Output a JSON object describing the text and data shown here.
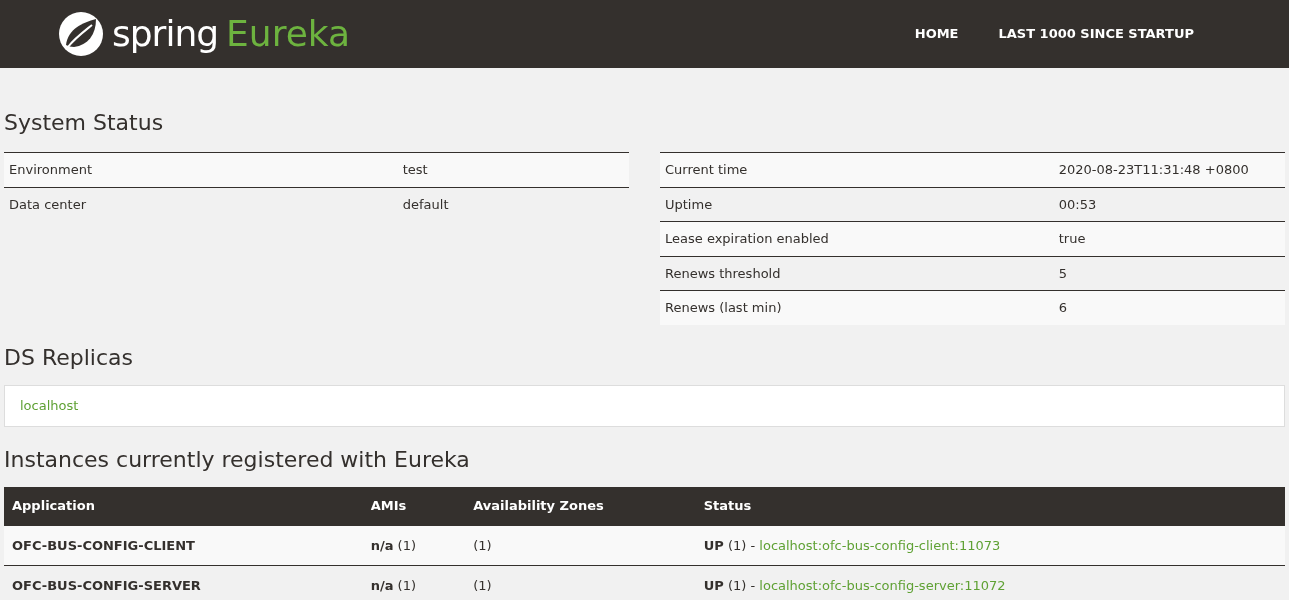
{
  "header": {
    "logo_word": "spring",
    "logo_product": "Eureka",
    "nav": [
      {
        "label": "HOME"
      },
      {
        "label": "LAST 1000 SINCE STARTUP"
      }
    ]
  },
  "system_status": {
    "title": "System Status",
    "left": [
      {
        "label": "Environment",
        "value": "test"
      },
      {
        "label": "Data center",
        "value": "default"
      }
    ],
    "right": [
      {
        "label": "Current time",
        "value": "2020-08-23T11:31:48 +0800"
      },
      {
        "label": "Uptime",
        "value": "00:53"
      },
      {
        "label": "Lease expiration enabled",
        "value": "true"
      },
      {
        "label": "Renews threshold",
        "value": "5"
      },
      {
        "label": "Renews (last min)",
        "value": "6"
      }
    ]
  },
  "ds_replicas": {
    "title": "DS Replicas",
    "items": [
      "localhost"
    ]
  },
  "instances": {
    "title": "Instances currently registered with Eureka",
    "columns": [
      "Application",
      "AMIs",
      "Availability Zones",
      "Status"
    ],
    "rows": [
      {
        "application": "OFC-BUS-CONFIG-CLIENT",
        "amis": "**n/a** (1)",
        "zones": "(1)",
        "status": "**UP** (1) - ",
        "link": "localhost:ofc-bus-config-client:11073"
      },
      {
        "application": "OFC-BUS-CONFIG-SERVER",
        "amis": "**n/a** (1)",
        "zones": "(1)",
        "status": "**UP** (1) - ",
        "link": "localhost:ofc-bus-config-server:11072"
      }
    ]
  }
}
